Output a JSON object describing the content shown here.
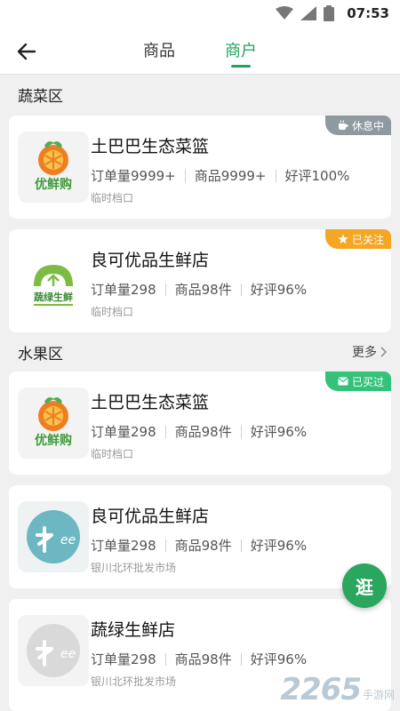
{
  "status_bar": {
    "time": "07:53"
  },
  "nav": {
    "tabs": [
      {
        "label": "商品"
      },
      {
        "label": "商户"
      }
    ],
    "active_tab": "商户"
  },
  "sections": [
    {
      "title": "蔬菜区"
    },
    {
      "title": "水果区",
      "more_label": "更多"
    }
  ],
  "cards": [
    {
      "name": "土巴巴生态菜篮",
      "stats": [
        "订单量9999+",
        "商品9999+",
        "好评100%"
      ],
      "location": "临时档口",
      "tag": {
        "label": "休息中",
        "icon": "coffee-icon",
        "color": "#8e9aa0"
      },
      "logo": {
        "name": "youxiangou-logo",
        "text": "优鲜购"
      }
    },
    {
      "name": "良可优品生鲜店",
      "stats": [
        "订单量298",
        "商品98件",
        "好评96%"
      ],
      "location": "临时档口",
      "tag": {
        "label": "已关注",
        "icon": "star-icon",
        "color": "#f5a623"
      },
      "logo": {
        "name": "shucaishengxian-logo",
        "text": "蔬绿生鲜"
      }
    },
    {
      "name": "土巴巴生态菜篮",
      "stats": [
        "订单量298",
        "商品98件",
        "好评96%"
      ],
      "location": "临时档口",
      "tag": {
        "label": "已买过",
        "icon": "mail-icon",
        "color": "#34c27a"
      },
      "logo": {
        "name": "youxiangou-logo",
        "text": "优鲜购"
      }
    },
    {
      "name": "良可优品生鲜店",
      "stats": [
        "订单量298",
        "商品98件",
        "好评96%"
      ],
      "location": "银川北环批发市场",
      "logo": {
        "name": "tree-logo-blue"
      }
    },
    {
      "name": "蔬绿生鲜店",
      "stats": [
        "订单量298",
        "商品98件",
        "好评96%"
      ],
      "location": "银川北环批发市场",
      "logo": {
        "name": "tree-logo-gray"
      }
    }
  ],
  "fab": {
    "label": "逛"
  },
  "watermark": {
    "number": "2265",
    "text": "手游网"
  },
  "colors": {
    "accent": "#1fa35b",
    "background": "#f0f0f0"
  }
}
